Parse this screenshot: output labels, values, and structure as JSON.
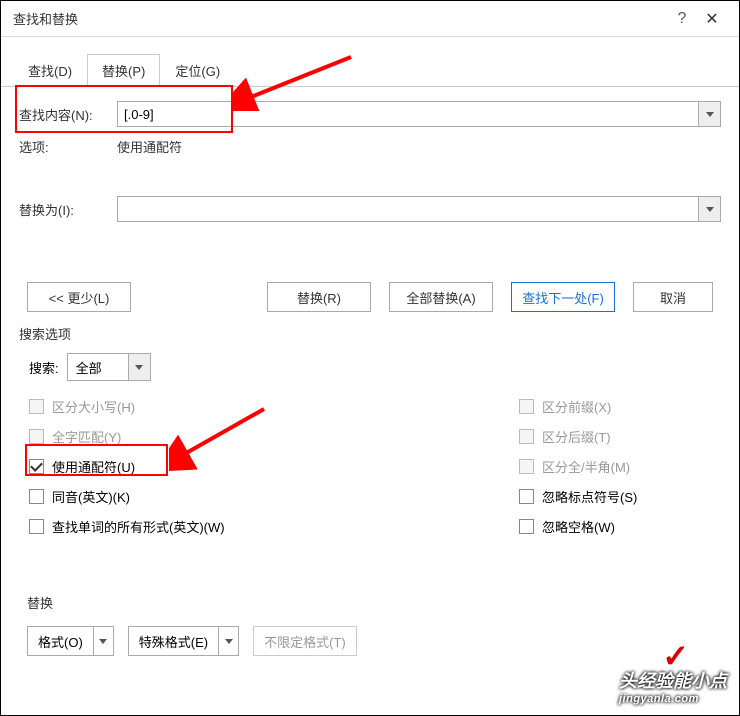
{
  "titlebar": {
    "title": "查找和替换",
    "help": "?",
    "close": "✕"
  },
  "tabs": {
    "find": "查找(D)",
    "replace": "替换(P)",
    "goto": "定位(G)"
  },
  "find": {
    "label": "查找内容(N):",
    "value": "[.0-9]"
  },
  "options": {
    "label": "选项:",
    "value": "使用通配符"
  },
  "replace": {
    "label": "替换为(I):",
    "value": ""
  },
  "buttons": {
    "less": "<< 更少(L)",
    "replace": "替换(R)",
    "replace_all": "全部替换(A)",
    "find_next": "查找下一处(F)",
    "cancel": "取消"
  },
  "search_options": {
    "title": "搜索选项",
    "search_label": "搜索:",
    "search_value": "全部",
    "left": [
      {
        "label": "区分大小写(H)",
        "checked": false,
        "disabled": true
      },
      {
        "label": "全字匹配(Y)",
        "checked": false,
        "disabled": true
      },
      {
        "label": "使用通配符(U)",
        "checked": true,
        "disabled": false
      },
      {
        "label": "同音(英文)(K)",
        "checked": false,
        "disabled": false
      },
      {
        "label": "查找单词的所有形式(英文)(W)",
        "checked": false,
        "disabled": false
      }
    ],
    "right": [
      {
        "label": "区分前缀(X)",
        "checked": false,
        "disabled": true
      },
      {
        "label": "区分后缀(T)",
        "checked": false,
        "disabled": true
      },
      {
        "label": "区分全/半角(M)",
        "checked": false,
        "disabled": true
      },
      {
        "label": "忽略标点符号(S)",
        "checked": false,
        "disabled": false
      },
      {
        "label": "忽略空格(W)",
        "checked": false,
        "disabled": false
      }
    ]
  },
  "replace_section": {
    "title": "替换",
    "format": "格式(O)",
    "special": "特殊格式(E)",
    "no_format": "不限定格式(T)"
  },
  "watermark": {
    "main": "头经验能小点",
    "sub": "jingyanla.com"
  }
}
